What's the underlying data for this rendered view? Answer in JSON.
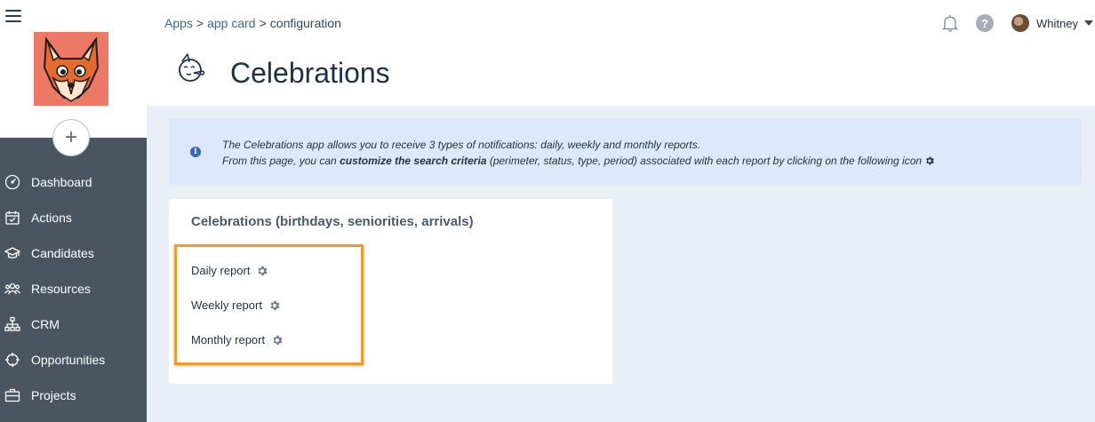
{
  "breadcrumb": {
    "apps": "Apps",
    "app_card": "app card",
    "current": "configuration",
    "separator": ">"
  },
  "page": {
    "title": "Celebrations"
  },
  "user": {
    "name": "Whitney"
  },
  "header": {
    "help_label": "?"
  },
  "sidebar": {
    "add_label": "+",
    "items": [
      {
        "label": "Dashboard",
        "icon": "dashboard-icon"
      },
      {
        "label": "Actions",
        "icon": "calendar-icon"
      },
      {
        "label": "Candidates",
        "icon": "graduation-cap-icon"
      },
      {
        "label": "Resources",
        "icon": "people-icon"
      },
      {
        "label": "CRM",
        "icon": "org-chart-icon"
      },
      {
        "label": "Opportunities",
        "icon": "crosshair-icon"
      },
      {
        "label": "Projects",
        "icon": "briefcase-icon"
      }
    ]
  },
  "info": {
    "icon_label": "i",
    "line1": "The Celebrations app allows you to receive 3 types of notifications: daily, weekly and monthly reports.",
    "line2_prefix": "From this page, you can ",
    "line2_bold": "customize the search criteria",
    "line2_suffix": " (perimeter, status, type, period) associated with each report by clicking on the following icon"
  },
  "card": {
    "title": "Celebrations (birthdays, seniorities, arrivals)",
    "reports": [
      {
        "label": "Daily report"
      },
      {
        "label": "Weekly report"
      },
      {
        "label": "Monthly report"
      }
    ]
  },
  "colors": {
    "accent_highlight": "#f39a2b",
    "sidebar_dark": "#4b5561",
    "logo_bg": "#ee7866",
    "info_bg": "#dde8fb"
  }
}
